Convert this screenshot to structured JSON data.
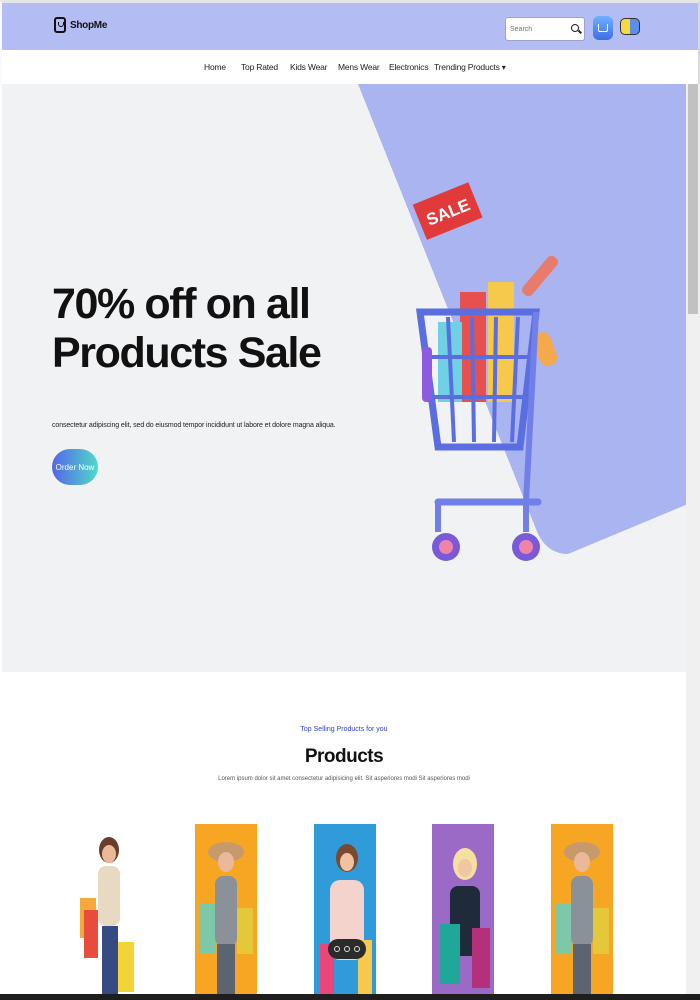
{
  "brand": {
    "name": "ShopMe",
    "icon": "shopping-bag-icon"
  },
  "header": {
    "search": {
      "placeholder": "Search",
      "value": "",
      "icon": "search-icon"
    },
    "cart_icon": "cart-icon",
    "user_icon": "user-toggle-icon"
  },
  "nav": {
    "items": [
      {
        "label": "Home"
      },
      {
        "label": "Top Rated"
      },
      {
        "label": "Kids Wear"
      },
      {
        "label": "Mens Wear"
      },
      {
        "label": "Electronics"
      },
      {
        "label": "Trending Products"
      }
    ]
  },
  "hero": {
    "title_line1": "70% off on all",
    "title_line2": "Products Sale",
    "subtitle": "consectetur adipiscing elit, sed do eiusmod tempor incididunt ut labore et dolore magna aliqua.",
    "button_label": "Order Now",
    "sale_tag": "SALE",
    "accent_color": "#a9b4f0"
  },
  "products": {
    "tag": "Top Selling Products for you",
    "title": "Products",
    "description": "Lorem ipsum dolor sit amet consectetur adipisicing elit. Sit asperiores modi Sit asperiores modi"
  },
  "colors": {
    "topbar": "#b3bdf3",
    "link": "#3140c9",
    "button_gradient_start": "#5566e8",
    "button_gradient_end": "#4fd9c9"
  }
}
